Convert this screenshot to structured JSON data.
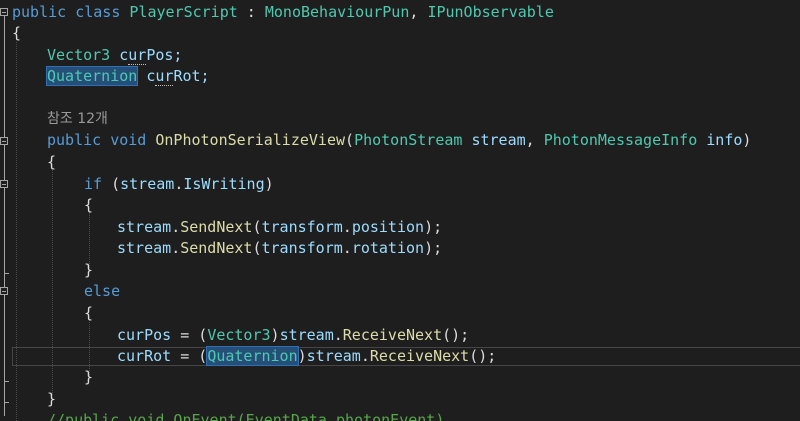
{
  "code": {
    "l1": {
      "kw1": "public",
      "kw2": "class",
      "cls": "PlayerScript",
      "colon": " : ",
      "base1": "MonoBehaviourPun",
      "comma": ", ",
      "base2": "IPunObservable"
    },
    "l2": {
      "brace": "{"
    },
    "l3": {
      "type": "Vector3",
      "sp": " ",
      "var_pre": "c",
      "var_dot": "ur",
      "var_post": "Pos;"
    },
    "l4": {
      "type": "Quaternion",
      "sp": " ",
      "var_pre": "c",
      "var_dot": "ur",
      "var_post": "Rot;"
    },
    "l5": {
      "refs": "참조 12개"
    },
    "l6": {
      "kw1": "public",
      "kw2": "void",
      "fn": "OnPhotonSerializeView",
      "p1": "(",
      "t1": "PhotonStream",
      "n1": "stream",
      "p2": ", ",
      "t2": "PhotonMessageInfo",
      "n2": "info",
      "p3": ")"
    },
    "l7": {
      "brace": "{"
    },
    "l8": {
      "kw": "if",
      "open": " (",
      "obj": "stream",
      "dot": ".",
      "prop": "IsWriting",
      "close": ")"
    },
    "l9": {
      "brace": "{"
    },
    "l10": {
      "obj": "stream",
      "dot": ".",
      "fn": "SendNext",
      "open": "(",
      "arg": "transform",
      "dot2": ".",
      "prop": "position",
      "close": ");"
    },
    "l11": {
      "obj": "stream",
      "dot": ".",
      "fn": "SendNext",
      "open": "(",
      "arg": "transform",
      "dot2": ".",
      "prop": "rotation",
      "close": ");"
    },
    "l12": {
      "brace": "}"
    },
    "l13": {
      "kw": "else"
    },
    "l14": {
      "brace": "{"
    },
    "l15": {
      "var": "curPos",
      "eq": " = (",
      "type": "Vector3",
      "cast_close": ")",
      "obj": "stream",
      "dot": ".",
      "fn": "ReceiveNext",
      "end": "();"
    },
    "l16": {
      "var": "curRot",
      "eq": " = (",
      "type": "Quaternion",
      "cast_close": ")",
      "obj": "stream",
      "dot": ".",
      "fn": "ReceiveNext",
      "end": "();"
    },
    "l17": {
      "brace": "}"
    },
    "l18": {
      "brace": "}"
    },
    "l19": {
      "comment": "//public void OnEvent(EventData photonEvent)"
    }
  },
  "colors": {
    "background": "#1e1e1e",
    "keyword": "#569cd6",
    "type": "#4ec9b0",
    "method": "#dcdcaa",
    "param": "#9cdcfe",
    "comment": "#57a64a",
    "selection": "#264f78"
  }
}
